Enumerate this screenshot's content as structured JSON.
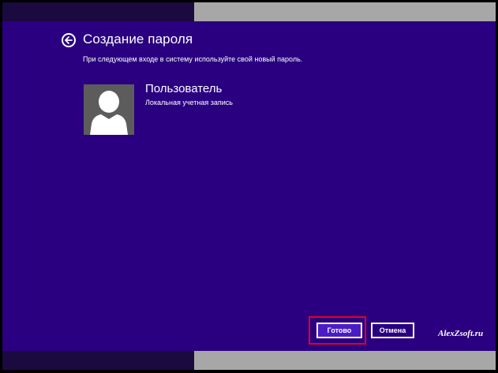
{
  "header": {
    "title": "Создание пароля",
    "subtitle": "При следующем входе в систему используйте свой новый пароль."
  },
  "user": {
    "name": "Пользователь",
    "account_type": "Локальная учетная запись"
  },
  "buttons": {
    "done": "Готово",
    "cancel": "Отмена"
  },
  "watermark": "AlexZsoft.ru",
  "icons": {
    "back": "back-arrow-icon",
    "avatar": "user-avatar-icon"
  },
  "colors": {
    "background": "#2a0080",
    "done_button": "#4b1cc6",
    "highlight_border": "#e0002a"
  }
}
